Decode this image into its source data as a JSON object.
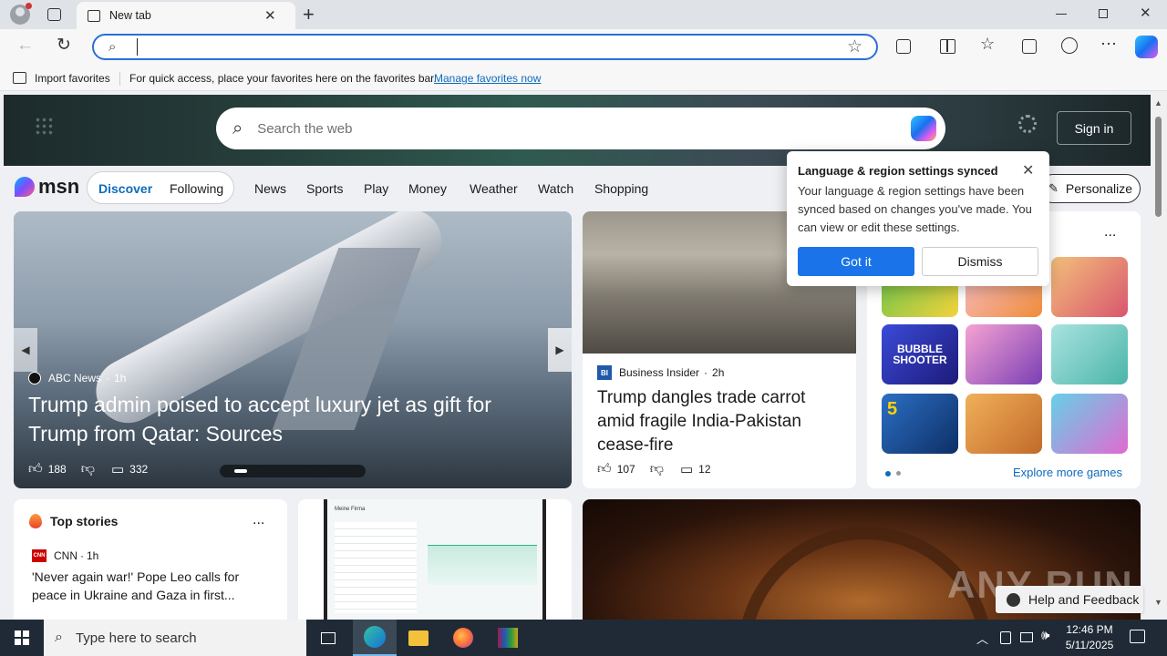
{
  "browser": {
    "tab_title": "New tab",
    "new_tab": "+",
    "address_value": "",
    "fav_import": "Import favorites",
    "fav_hint": "For quick access, place your favorites here on the favorites bar.",
    "fav_manage": "Manage favorites now"
  },
  "header": {
    "search_placeholder": "Search the web",
    "sign_in": "Sign in"
  },
  "nav": {
    "logo": "msn",
    "tabs": [
      "Discover",
      "Following"
    ],
    "links": [
      "News",
      "Sports",
      "Play",
      "Money",
      "Weather",
      "Watch",
      "Shopping"
    ],
    "personalize": "Personalize"
  },
  "hero": {
    "source": "ABC News",
    "age": "1h",
    "headline": "Trump admin poised to accept luxury jet as gift for Trump from Qatar: Sources",
    "likes": "188",
    "comments": "332"
  },
  "story2": {
    "source": "Business Insider",
    "age": "2h",
    "source_badge": "BI",
    "headline": "Trump dangles trade carrot amid fragile India-Pakistan cease-fire",
    "likes": "107",
    "comments": "12"
  },
  "games": {
    "more": "...",
    "explore": "Explore more games",
    "bubble_label": "BUBBLE SHOOTER",
    "five_label": "5"
  },
  "top_stories": {
    "title": "Top stories",
    "more": "...",
    "source": "CNN",
    "age": "1h",
    "source_badge": "CNN",
    "headline": "'Never again war!' Pope Leo calls for peace in Ukraine and Gaza in first...",
    "card_title": "Meine Firma"
  },
  "popup": {
    "title": "Language & region settings synced",
    "body": "Your language & region settings have been synced based on changes you've made. You can view or edit these settings.",
    "primary": "Got it",
    "secondary": "Dismiss"
  },
  "help": {
    "label": "Help and Feedback"
  },
  "watermark": "ANY RUN",
  "taskbar": {
    "search_placeholder": "Type here to search",
    "time": "12:46 PM",
    "date": "5/11/2025"
  },
  "colors": {
    "accent": "#0f6cbd",
    "popup_button": "#1a73e8",
    "taskbar": "#1f2a36"
  }
}
